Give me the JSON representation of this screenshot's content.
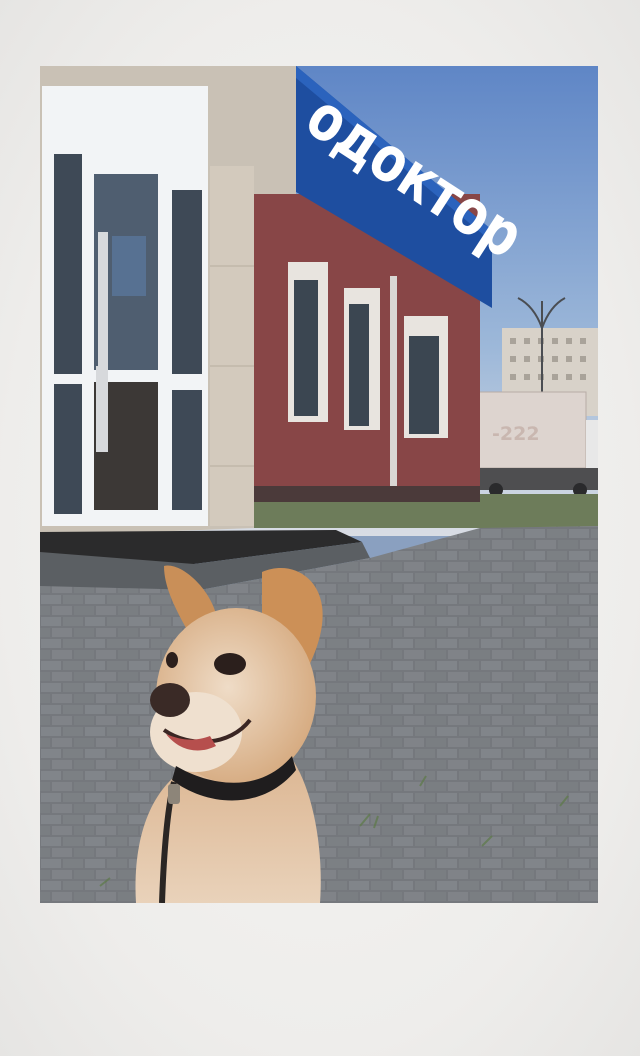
{
  "photo": {
    "sign_text": "одоктор",
    "truck_text": "-222"
  }
}
